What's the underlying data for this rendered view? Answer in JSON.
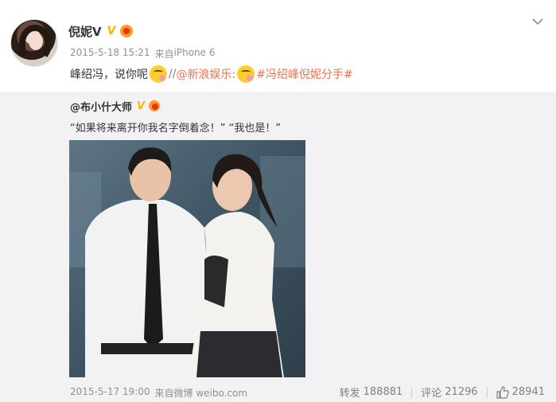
{
  "post": {
    "author": "倪妮V",
    "verified_badge": "V",
    "time": "2015-5-18 15:21",
    "source_prefix": "来自",
    "source": "iPhone 6",
    "text_prefix": "峰绍冯，说你呢",
    "separator": "//",
    "mention": "@新浪娱乐:",
    "hashtag": "#冯绍峰倪妮分手#"
  },
  "repost": {
    "author": "@布小什大师",
    "verified_badge": "V",
    "text": "“如果将来离开你我名字倒着念！” “我也是！”",
    "time": "2015-5-17 19:00",
    "source_prefix": "来自",
    "source": "微博 weibo.com",
    "forward_label": "转发",
    "forward_count": "188881",
    "comment_label": "评论",
    "comment_count": "21296",
    "like_count": "28941"
  },
  "colors": {
    "link": "#eb7350",
    "verified": "#f7b500",
    "repost_bg": "#f2f2f5",
    "meta_text": "#909090"
  },
  "icons": {
    "menu": "chevron-down-icon",
    "emoji": "thinking-face-emoji",
    "medal": "member-medal-icon",
    "like": "thumbs-up-icon"
  }
}
